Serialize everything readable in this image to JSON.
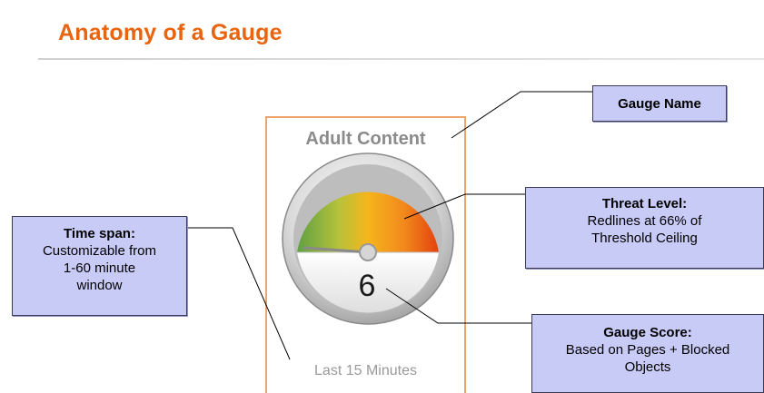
{
  "page": {
    "title": "Anatomy of a Gauge"
  },
  "gauge": {
    "name": "Adult Content",
    "score": "6",
    "footer": "Last 15 Minutes",
    "colors": {
      "frame": "#f0a46a",
      "low": "#6aa84f",
      "mid": "#f4b400",
      "high": "#e8400e",
      "needle": "#9a9a9a"
    }
  },
  "callouts": {
    "gauge_name": {
      "title": "Gauge Name"
    },
    "threat_level": {
      "title": "Threat Level:",
      "line1": "Redlines at 66% of",
      "line2": "Threshold Ceiling"
    },
    "time_span": {
      "title": "Time span:",
      "line1": "Customizable from",
      "line2": "1-60 minute",
      "line3": "window"
    },
    "gauge_score": {
      "title": "Gauge Score:",
      "line1": "Based on Pages + Blocked",
      "line2": "Objects"
    }
  }
}
